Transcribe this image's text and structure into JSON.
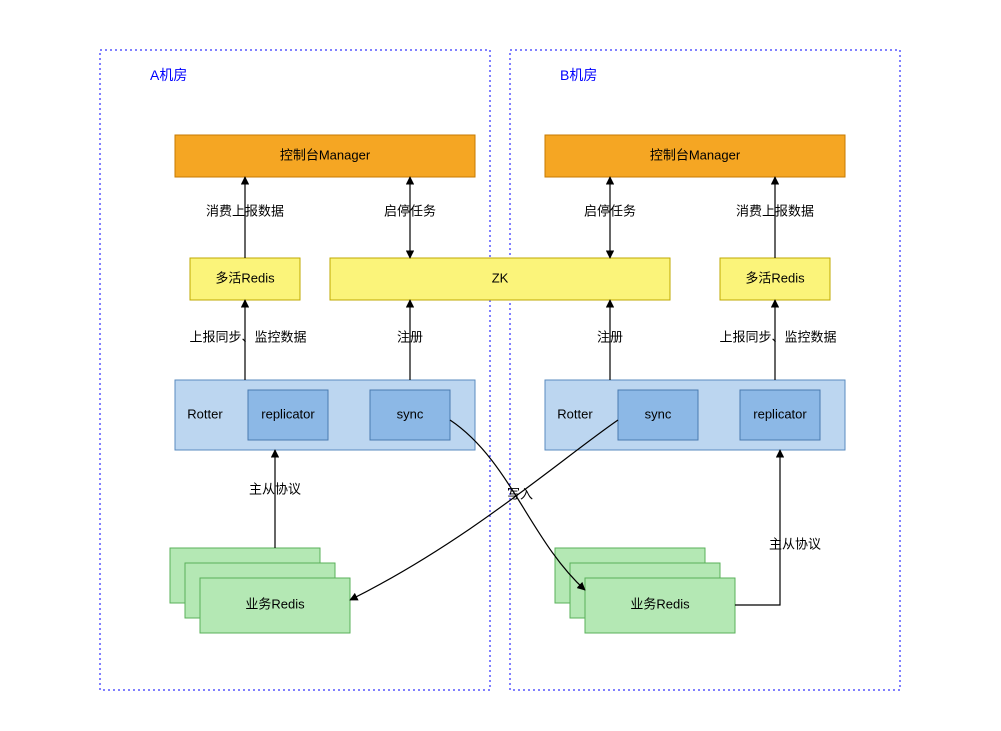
{
  "regions": {
    "a": {
      "title": "A机房"
    },
    "b": {
      "title": "B机房"
    }
  },
  "boxes": {
    "manager_a": "控制台Manager",
    "manager_b": "控制台Manager",
    "redis_a": "多活Redis",
    "redis_b": "多活Redis",
    "zk": "ZK",
    "rotter_a": "Rotter",
    "rotter_b": "Rotter",
    "replicator_a": "replicator",
    "replicator_b": "replicator",
    "sync_a": "sync",
    "sync_b": "sync",
    "biz_a": "业务Redis",
    "biz_b": "业务Redis"
  },
  "edges": {
    "consume_a": "消费上报数据",
    "consume_b": "消费上报数据",
    "startstop_a": "启停任务",
    "startstop_b": "启停任务",
    "report_a": "上报同步、监控数据",
    "report_b": "上报同步、监控数据",
    "register_a": "注册",
    "register_b": "注册",
    "master_a": "主从协议",
    "master_b": "主从协议",
    "write": "写入"
  }
}
